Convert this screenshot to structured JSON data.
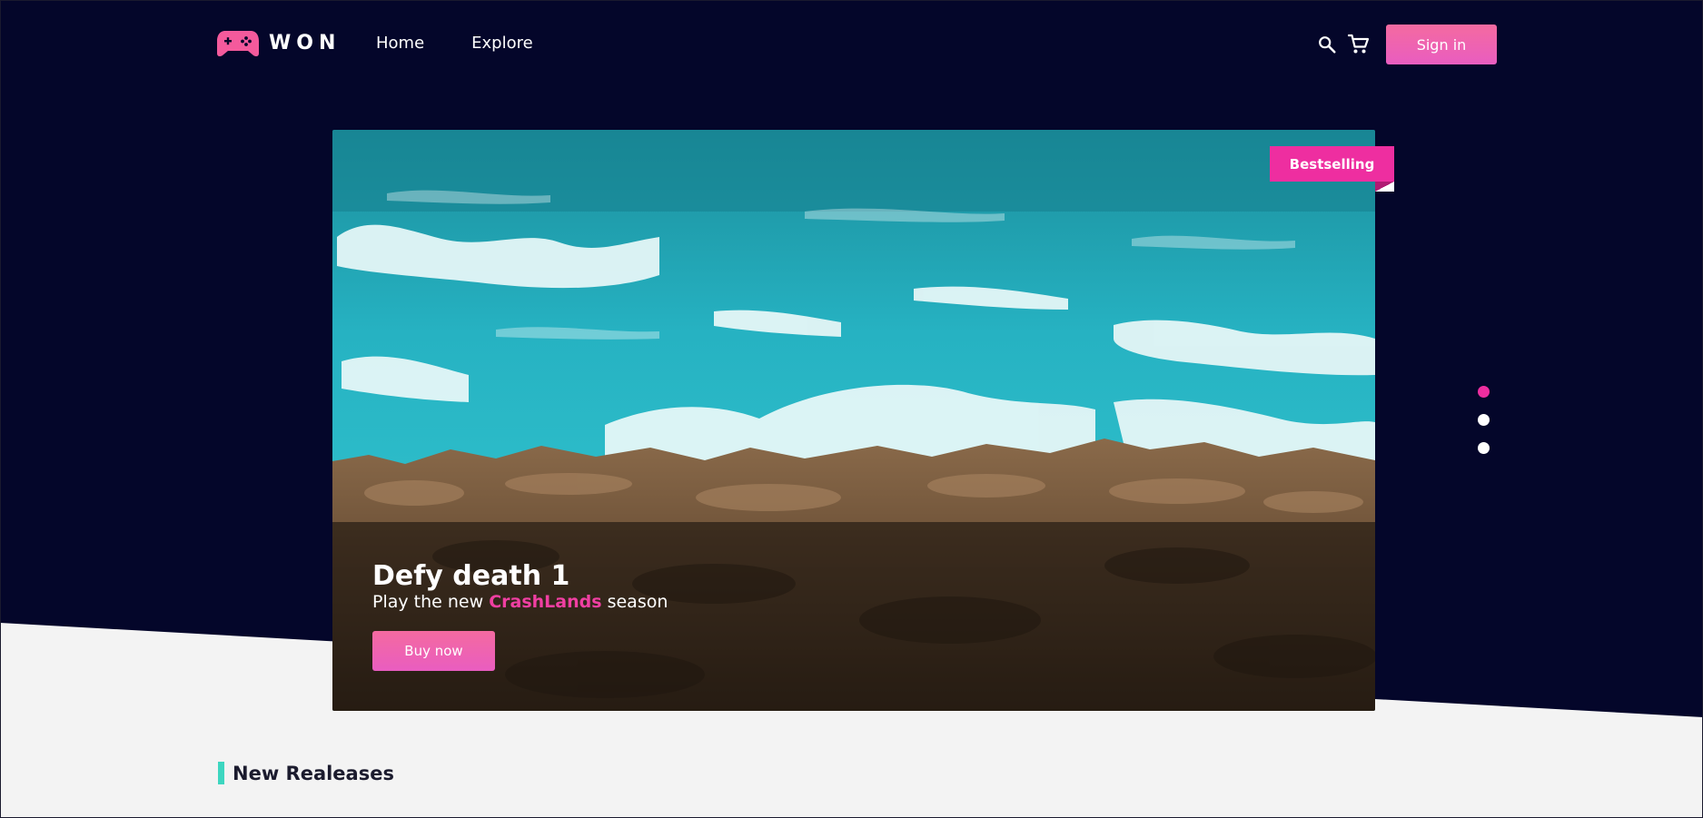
{
  "brand": {
    "name": "WON",
    "icon": "gamepad-icon",
    "accent": "#f45a9c"
  },
  "nav": {
    "items": [
      {
        "label": "Home"
      },
      {
        "label": "Explore"
      }
    ]
  },
  "header": {
    "search_icon": "search-icon",
    "cart_icon": "cart-icon",
    "signin_label": "Sign in"
  },
  "hero": {
    "badge": "Bestselling",
    "title": "Defy death 1",
    "subtitle_prefix": "Play the new ",
    "subtitle_highlight": "CrashLands",
    "subtitle_suffix": " season",
    "cta_label": "Buy now",
    "image": "ocean-waves-on-rocky-shore",
    "slides_total": 3,
    "active_slide": 1
  },
  "sections": {
    "new_releases": {
      "title": "New Realeases"
    }
  },
  "colors": {
    "background_dark": "#04062a",
    "background_light": "#f3f3f3",
    "pink": "#ee2ea0",
    "button_gradient_top": "#f46aa0",
    "button_gradient_bottom": "#e95dc0",
    "teal_accent": "#3dd6c0"
  }
}
